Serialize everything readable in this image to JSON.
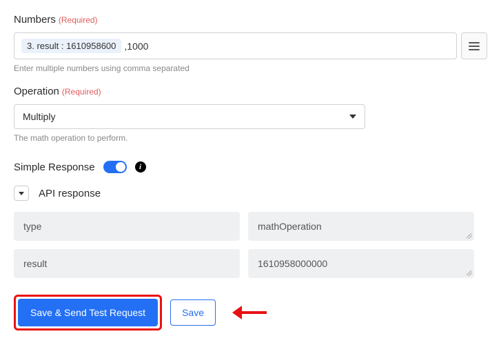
{
  "numbers": {
    "label": "Numbers",
    "required": "(Required)",
    "pill": "3. result : 1610958600",
    "after": ",1000",
    "help": "Enter multiple numbers using comma separated"
  },
  "operation": {
    "label": "Operation",
    "required": "(Required)",
    "value": "Multiply",
    "help": "The math operation to perform."
  },
  "simpleResponse": {
    "label": "Simple Response"
  },
  "apiResponse": {
    "label": "API response",
    "rows": [
      {
        "key": "type",
        "value": "mathOperation"
      },
      {
        "key": "result",
        "value": "1610958000000"
      }
    ]
  },
  "actions": {
    "primary": "Save & Send Test Request",
    "secondary": "Save"
  }
}
